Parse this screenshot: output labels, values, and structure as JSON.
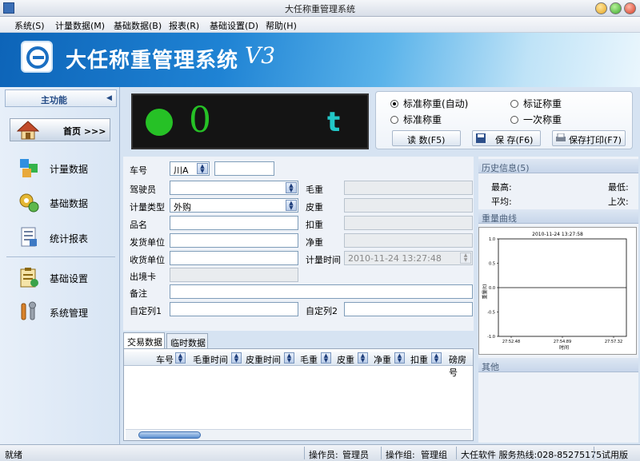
{
  "window": {
    "title": "大任称重管理系统"
  },
  "menu": [
    "系统(S)",
    "计量数据(M)",
    "基础数据(B)",
    "报表(R)",
    "基础设置(D)",
    "帮助(H)"
  ],
  "banner": {
    "title": "大任称重管理系统",
    "version": "V3"
  },
  "sidebar": {
    "header": "主功能",
    "home": "首页 >>>",
    "items": [
      "计量数据",
      "基础数据",
      "统计报表",
      "基础设置",
      "系统管理"
    ]
  },
  "display": {
    "weight": "0",
    "unit": "t"
  },
  "modes": {
    "standard_auto": "标准称重(自动)",
    "certified": "标证称重",
    "standard": "标准称重",
    "once": "一次称重",
    "read_btn": "读 数(F5)",
    "save_btn": "保 存(F6)",
    "save_print_btn": "保存打印(F7)"
  },
  "form": {
    "plate_label": "车号",
    "plate_prefix": "川A",
    "driver_label": "驾驶员",
    "type_label": "计量类型",
    "type_value": "外购",
    "product_label": "品名",
    "sender_label": "发货单位",
    "receiver_label": "收货单位",
    "card_label": "出境卡",
    "remark_label": "备注",
    "custom1_label": "自定列1",
    "custom2_label": "自定列2",
    "gross_label": "毛重",
    "tare_label": "皮重",
    "deduct_label": "扣重",
    "net_label": "净重",
    "time_label": "计量时间",
    "time_value": "2010-11-24 13:27:48"
  },
  "tabs": [
    "交易数据",
    "临时数据"
  ],
  "grid": {
    "columns": [
      "车号",
      "毛重时间",
      "皮重时间",
      "毛重",
      "皮重",
      "净重",
      "扣重",
      "磅房号"
    ]
  },
  "right": {
    "stats_header": "历史信息(5)",
    "max_label": "最高:",
    "min_label": "最低:",
    "avg_label": "平均:",
    "last_label": "上次:",
    "curve_header": "重量曲线",
    "log_header": "其他"
  },
  "chart_data": {
    "type": "line",
    "title": "2010-11-24 13:27:58",
    "xlabel": "时间",
    "ylabel": "重量(t)",
    "ylim": [
      -1.0,
      1.0
    ],
    "yticks": [
      "1.0",
      "0.5",
      "0.0",
      "-0.5",
      "-1.0"
    ],
    "xticks": [
      "27:52.48",
      "27:54.89",
      "27:57.32"
    ],
    "series": [
      {
        "name": "",
        "values": [
          0,
          0,
          0,
          0,
          0
        ]
      }
    ]
  },
  "status": {
    "state": "就绪",
    "operator_label": "操作员:",
    "operator": "管理员",
    "group_label": "操作组:",
    "group": "管理组",
    "hotline": "大任软件 服务热线:028-85275175",
    "edition": "试用版"
  },
  "colors": {
    "display_green": "#26c126",
    "display_cyan": "#22c8c8",
    "banner_blue": "#1f83d4"
  }
}
